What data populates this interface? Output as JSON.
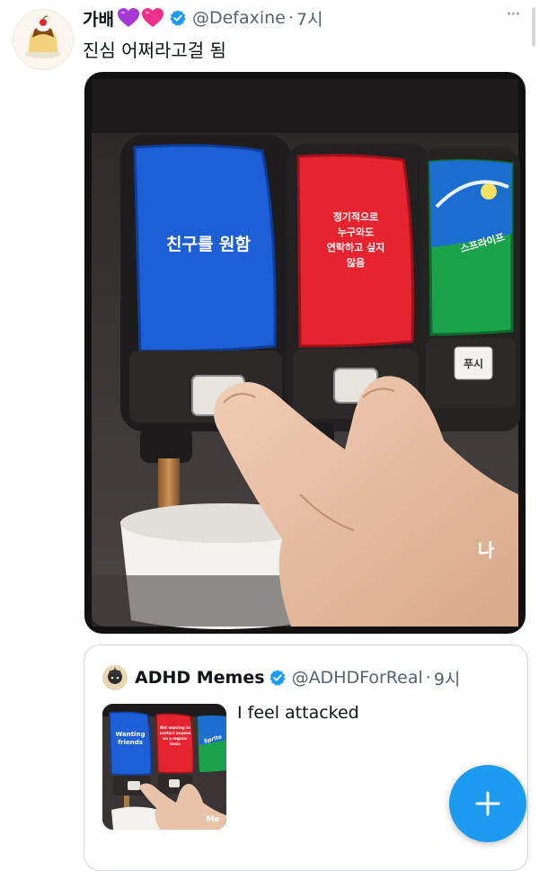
{
  "tweet": {
    "display_name": "가배",
    "name_emoji_icons": [
      "purple-heart-icon",
      "pink-heart-icon"
    ],
    "verified_icon": "verified-badge-icon",
    "handle": "@Defaxine",
    "separator": "·",
    "time": "7시",
    "more_icon": "more-dots-icon",
    "more_glyph": "···",
    "text": "진심 어쩌라고걸 됨",
    "avatar_icon": "pudding-avatar-icon",
    "media": {
      "image_icon": "soda-dispenser-meme",
      "labels": {
        "blue": "친구를 원함",
        "red_lines": [
          "정기적으로",
          "누구와도",
          "연락하고 싶지",
          "않음"
        ],
        "green": "스프라이프",
        "push": "푸시",
        "me": "나"
      }
    }
  },
  "quote": {
    "display_name": "ADHD Memes",
    "verified_icon": "verified-badge-icon",
    "handle": "@ADHDForReal",
    "separator": "·",
    "time": "9시",
    "text": "I feel attacked",
    "avatar_icon": "adhd-avatar-icon",
    "thumb_icon": "soda-dispenser-meme-thumbnail",
    "thumb_labels": {
      "blue": "Wanting friends",
      "red": "Not wanting to contact anyone on a regular basis",
      "green": "Sprite",
      "me": "Me"
    }
  },
  "fab": {
    "icon": "compose-plus-icon",
    "glyph": "+"
  },
  "colors": {
    "accent": "#1d9bf0",
    "text": "#0f1419",
    "muted": "#536471",
    "blue_label": "#1c5fd6",
    "red_label": "#e5242f",
    "green_label": "#1aa34a"
  }
}
